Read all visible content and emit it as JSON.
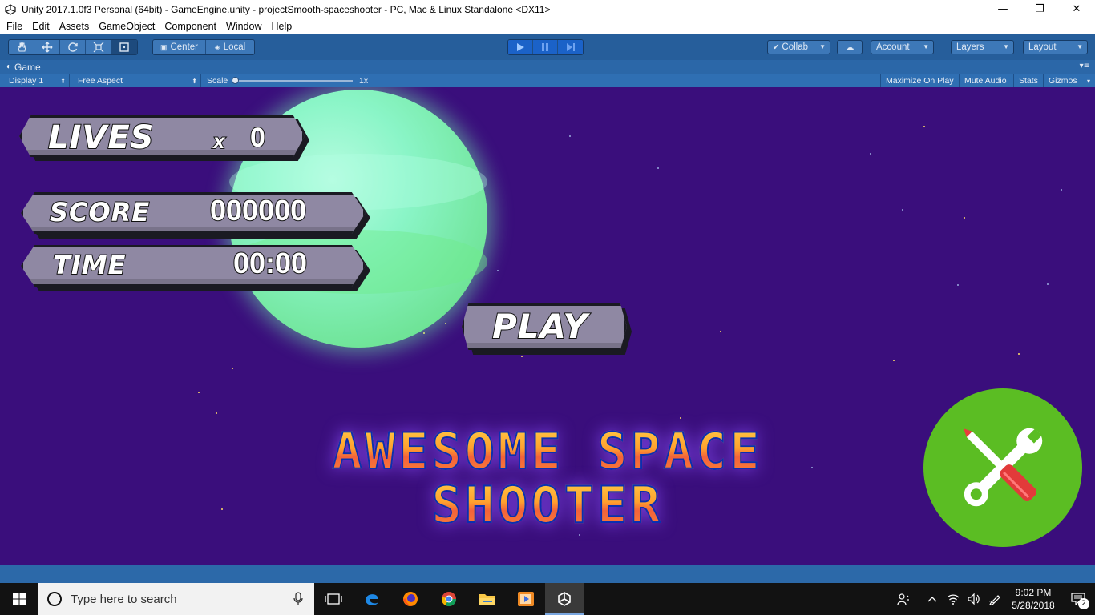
{
  "window": {
    "title": "Unity 2017.1.0f3 Personal (64bit) - GameEngine.unity - projectSmooth-spaceshooter - PC, Mac & Linux Standalone <DX11>",
    "minimize": "—",
    "maximize": "❐",
    "close": "✕"
  },
  "menu": [
    "File",
    "Edit",
    "Assets",
    "GameObject",
    "Component",
    "Window",
    "Help"
  ],
  "toolbar": {
    "tools": [
      "hand-icon",
      "move-icon",
      "rotate-icon",
      "scale-icon",
      "rect-tool-icon"
    ],
    "pivot": "Center",
    "space": "Local",
    "collab": "Collab",
    "account": "Account",
    "layers": "Layers",
    "layout": "Layout"
  },
  "panel": {
    "tab": "Game",
    "display": "Display 1",
    "aspect": "Free Aspect",
    "scale_label": "Scale",
    "scale_value": "1x",
    "maximize_on_play": "Maximize On Play",
    "mute_audio": "Mute Audio",
    "stats": "Stats",
    "gizmos": "Gizmos"
  },
  "game": {
    "lives_label": "LIVES",
    "lives_x": "x",
    "lives_value": "0",
    "score_label": "SCORE",
    "score_value": "000000",
    "time_label": "TIME",
    "time_value": "00:00",
    "play_label": "PLAY",
    "title_line1": "AWESOME SPACE",
    "title_line2": "SHOOTER"
  },
  "taskbar": {
    "search_placeholder": "Type here to search",
    "time": "9:02 PM",
    "date": "5/28/2018",
    "notifications": "2"
  }
}
